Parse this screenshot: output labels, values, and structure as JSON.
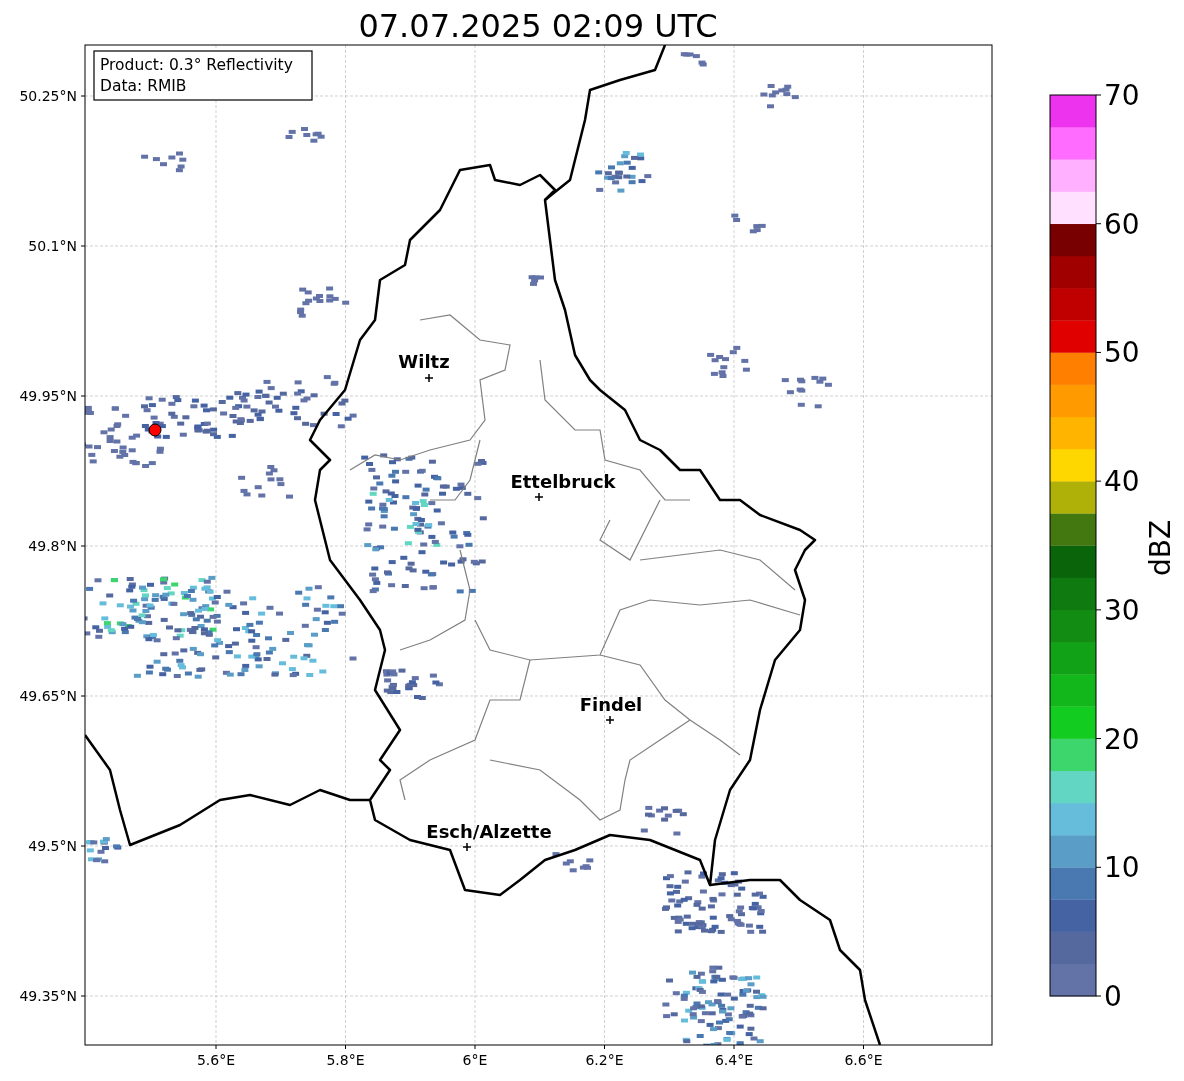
{
  "title": "07.07.2025 02:09 UTC",
  "legend": [
    "Product: 0.3° Reflectivity",
    "Data: RMIB"
  ],
  "map": {
    "yticks": [
      "50.25°N",
      "50.1°N",
      "49.95°N",
      "49.8°N",
      "49.65°N",
      "49.5°N",
      "49.35°N"
    ],
    "xticks": [
      "5.6°E",
      "5.8°E",
      "6°E",
      "6.2°E",
      "6.4°E",
      "6.6°E"
    ],
    "places": [
      {
        "name": "Wiltz"
      },
      {
        "name": "Ettelbruck"
      },
      {
        "name": "Findel"
      },
      {
        "name": "Esch/Alzette"
      }
    ]
  },
  "colorbar": {
    "label": "dBZ",
    "ticks": [
      "70",
      "60",
      "50",
      "40",
      "30",
      "20",
      "10",
      "0"
    ],
    "bins": [
      {
        "color": "#6373a8"
      },
      {
        "color": "#56699e"
      },
      {
        "color": "#4562a3"
      },
      {
        "color": "#4a78b0"
      },
      {
        "color": "#5a9ec8"
      },
      {
        "color": "#66bddb"
      },
      {
        "color": "#62d6c2"
      },
      {
        "color": "#3dd66c"
      },
      {
        "color": "#12cc1f"
      },
      {
        "color": "#12b81b"
      },
      {
        "color": "#12a217"
      },
      {
        "color": "#138c14"
      },
      {
        "color": "#0f7a0f"
      },
      {
        "color": "#0a650a"
      },
      {
        "color": "#437710"
      },
      {
        "color": "#afb108"
      },
      {
        "color": "#ffd700"
      },
      {
        "color": "#ffb400"
      },
      {
        "color": "#ff9a00"
      },
      {
        "color": "#ff7f00"
      },
      {
        "color": "#e00000"
      },
      {
        "color": "#c00000"
      },
      {
        "color": "#a00000"
      },
      {
        "color": "#780000"
      },
      {
        "color": "#ffe0ff"
      },
      {
        "color": "#ffb0ff"
      },
      {
        "color": "#ff6cff"
      },
      {
        "color": "#ee33ee"
      }
    ]
  }
}
